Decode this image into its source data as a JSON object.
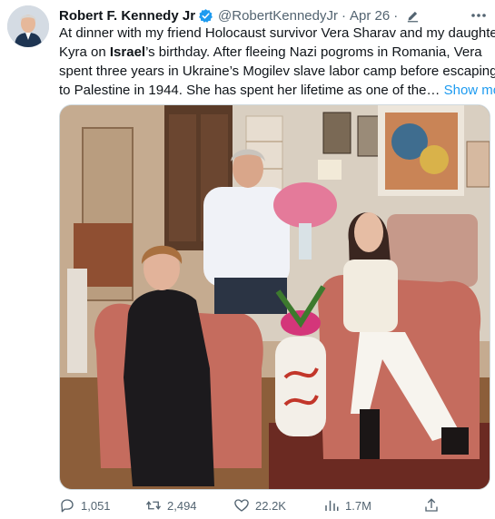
{
  "author": {
    "name": "Robert F. Kennedy Jr",
    "handle": "@RobertKennedyJr",
    "date": "Apr 26",
    "separator": "·"
  },
  "tweet": {
    "line1": "At dinner with my friend Holocaust survivor Vera Sharav and my daughter",
    "line2_pre": "Kyra on ",
    "line2_bold": "Israel",
    "line2_post": "’s birthday. After fleeing Nazi pogroms in Romania, Vera",
    "line3": "spent three years in Ukraine’s Mogilev slave labor camp before escaping",
    "line4": "to Palestine in 1944. She has spent her lifetime as one of the…",
    "show_more": "Show more"
  },
  "actions": {
    "replies": "1,051",
    "retweets": "2,494",
    "likes": "22.2K",
    "views": "1.7M"
  },
  "colors": {
    "accent": "#1d9bf0",
    "secondary_text": "#536471",
    "primary_text": "#0f1419"
  },
  "icons": [
    "verified-badge-icon",
    "edit-icon",
    "more-icon",
    "reply-icon",
    "retweet-icon",
    "like-icon",
    "views-icon",
    "share-icon"
  ]
}
